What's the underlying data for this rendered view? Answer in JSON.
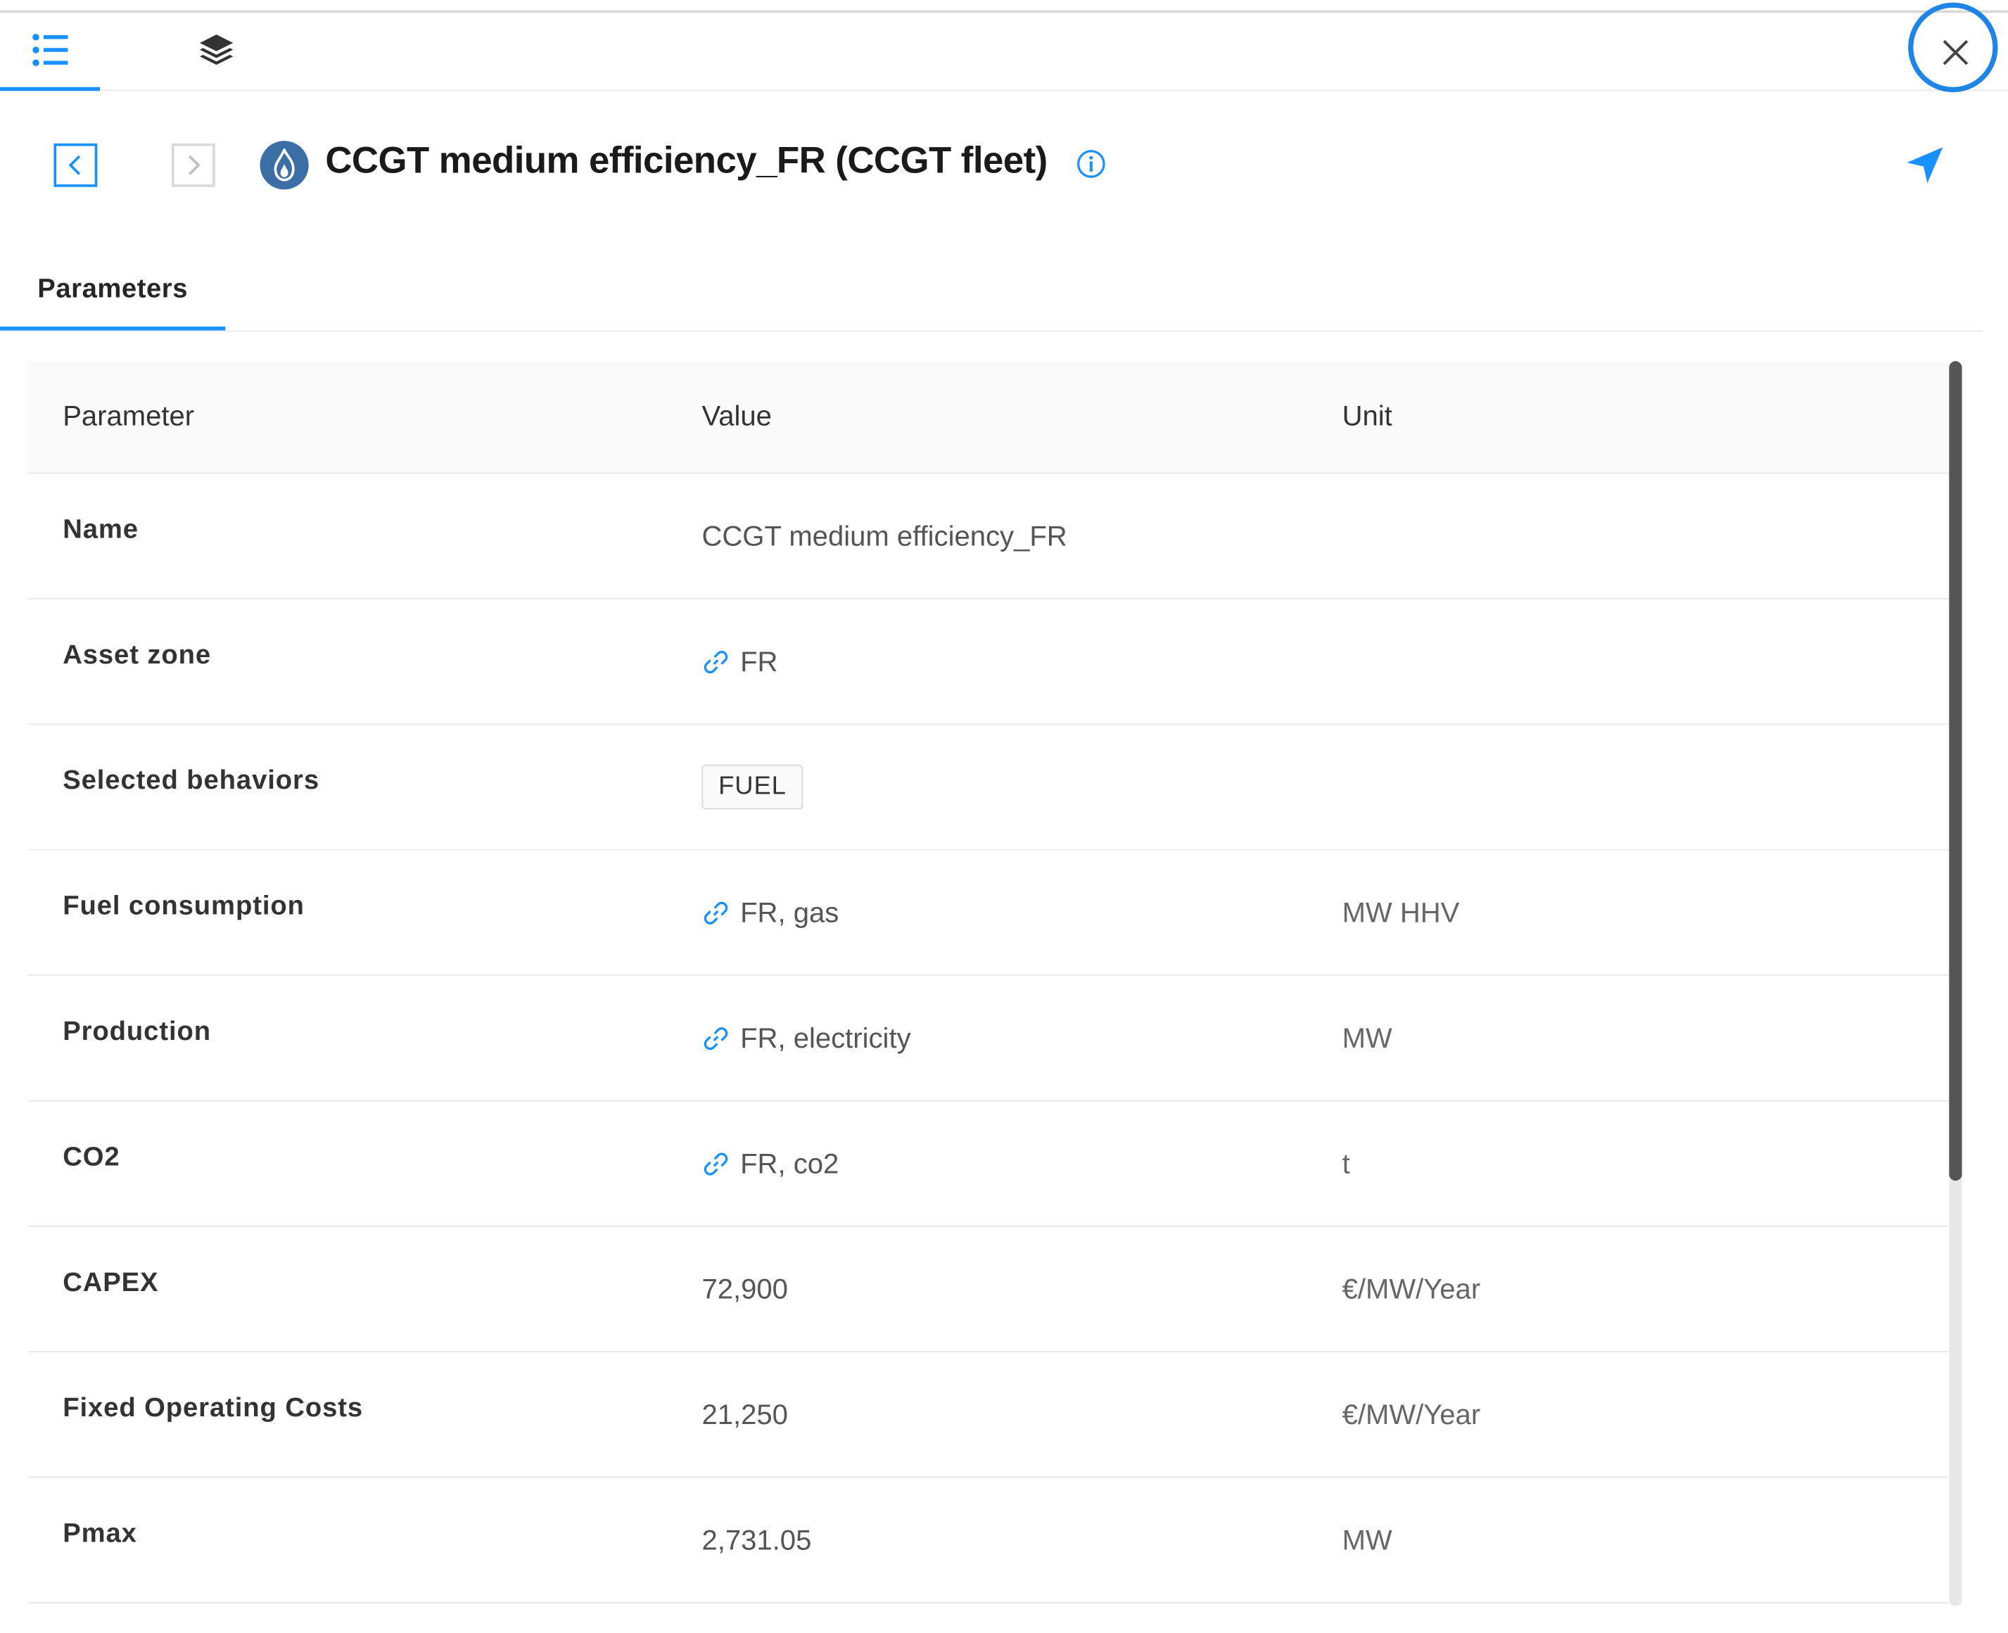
{
  "header": {
    "title": "CCGT medium efficiency_FR (CCGT fleet)"
  },
  "section_tabs": [
    {
      "label": "Parameters"
    }
  ],
  "table": {
    "columns": [
      "Parameter",
      "Value",
      "Unit"
    ],
    "rows": [
      {
        "parameter": "Name",
        "value": "CCGT medium efficiency_FR",
        "unit": "",
        "linked": false,
        "tag": false
      },
      {
        "parameter": "Asset zone",
        "value": "FR",
        "unit": "",
        "linked": true,
        "tag": false
      },
      {
        "parameter": "Selected behaviors",
        "value": "FUEL",
        "unit": "",
        "linked": false,
        "tag": true
      },
      {
        "parameter": "Fuel consumption",
        "value": "FR, gas",
        "unit": "MW HHV",
        "linked": true,
        "tag": false
      },
      {
        "parameter": "Production",
        "value": "FR, electricity",
        "unit": "MW",
        "linked": true,
        "tag": false
      },
      {
        "parameter": "CO2",
        "value": "FR, co2",
        "unit": "t",
        "linked": true,
        "tag": false
      },
      {
        "parameter": "CAPEX",
        "value": "72,900",
        "unit": "€/MW/Year",
        "linked": false,
        "tag": false
      },
      {
        "parameter": "Fixed Operating Costs",
        "value": "21,250",
        "unit": "€/MW/Year",
        "linked": false,
        "tag": false
      },
      {
        "parameter": "Pmax",
        "value": "2,731.05",
        "unit": "MW",
        "linked": false,
        "tag": false
      }
    ]
  },
  "icons": {
    "list_tab": "list-icon",
    "layers_tab": "layers-icon",
    "close": "close-icon",
    "prev": "chevron-left-icon",
    "next": "chevron-right-icon",
    "asset": "gas-flame-icon",
    "info": "info-icon",
    "locate": "navigate-arrow-icon",
    "link": "link-icon"
  },
  "colors": {
    "accent": "#1890ff",
    "highlight_ring": "#1f84e6",
    "asset_icon_bg": "#3a6ea5"
  }
}
